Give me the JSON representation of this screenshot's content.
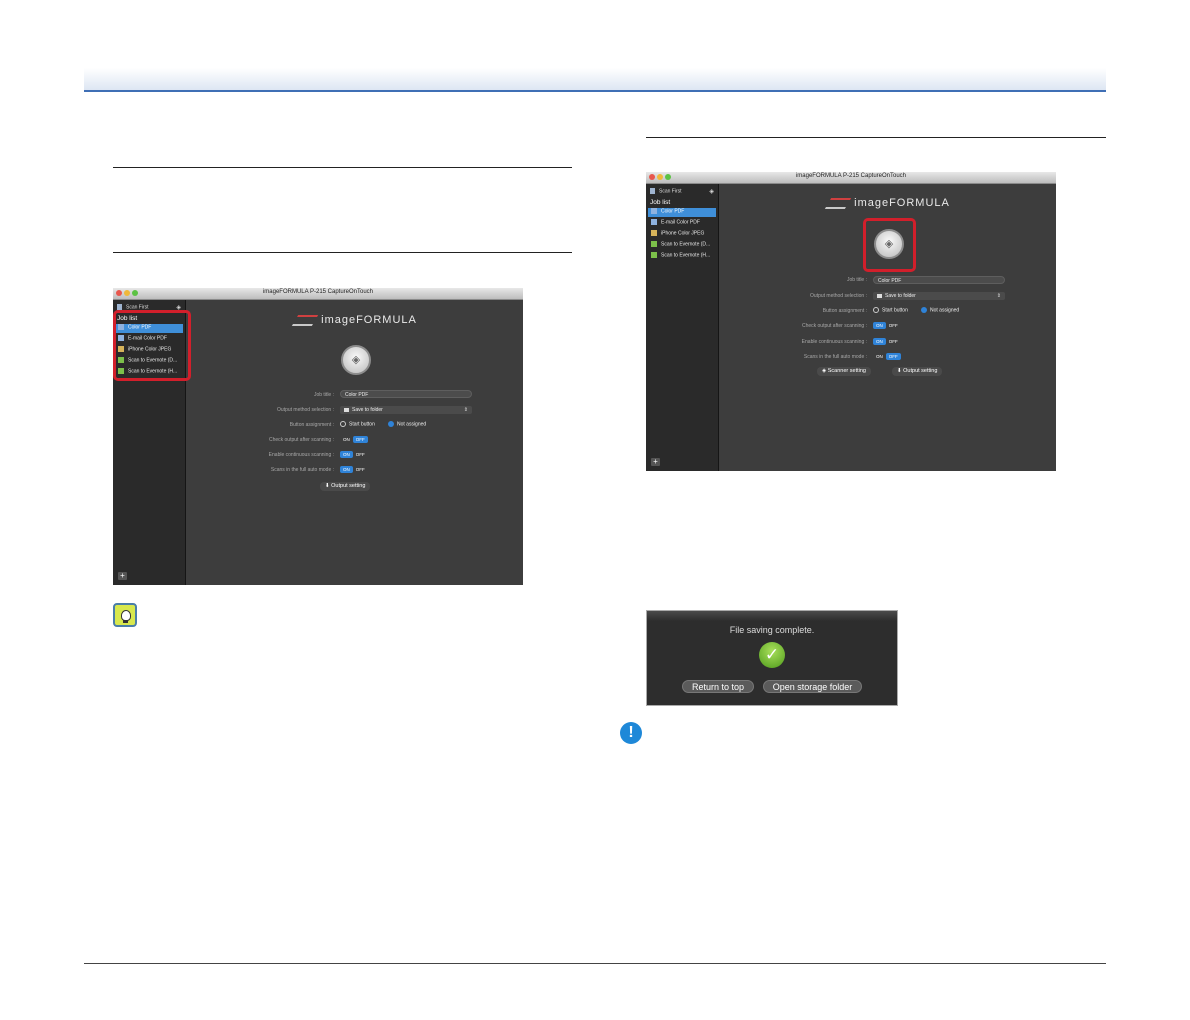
{
  "app": {
    "window_title": "imageFORMULA P-215 CaptureOnTouch",
    "logo_text": "imageFORMULA"
  },
  "sidebar": {
    "scan_first": "Scan First",
    "job_list_header": "Job list",
    "items": [
      {
        "label": "Color PDF",
        "selected": true
      },
      {
        "label": "E-mail Color PDF"
      },
      {
        "label": "iPhone Color JPEG"
      },
      {
        "label": "Scan to Evernote (D..."
      },
      {
        "label": "Scan to Evernote (H..."
      }
    ],
    "add_label": "+"
  },
  "form": {
    "job_title_label": "Job title :",
    "job_title_value": "Color PDF",
    "output_method_label": "Output method selection :",
    "output_method_value": "Save to folder",
    "button_assignment_label": "Button assignment :",
    "start_button_label": "Start button",
    "not_assigned_label": "Not assigned",
    "check_output_label": "Check output after scanning :",
    "enable_continuous_label": "Enable continuous scanning :",
    "full_auto_label": "Scans in the full auto mode :",
    "on_label": "ON",
    "off_label": "OFF"
  },
  "buttons": {
    "scanner_setting": "Scanner setting",
    "output_setting": "Output setting"
  },
  "dialog": {
    "message": "File saving complete.",
    "return_to_top": "Return to top",
    "open_storage_folder": "Open storage folder"
  },
  "colors": {
    "callout": "#d21f2b",
    "accent_blue": "#3f6fb5",
    "toggle_blue": "#2f83d8"
  }
}
